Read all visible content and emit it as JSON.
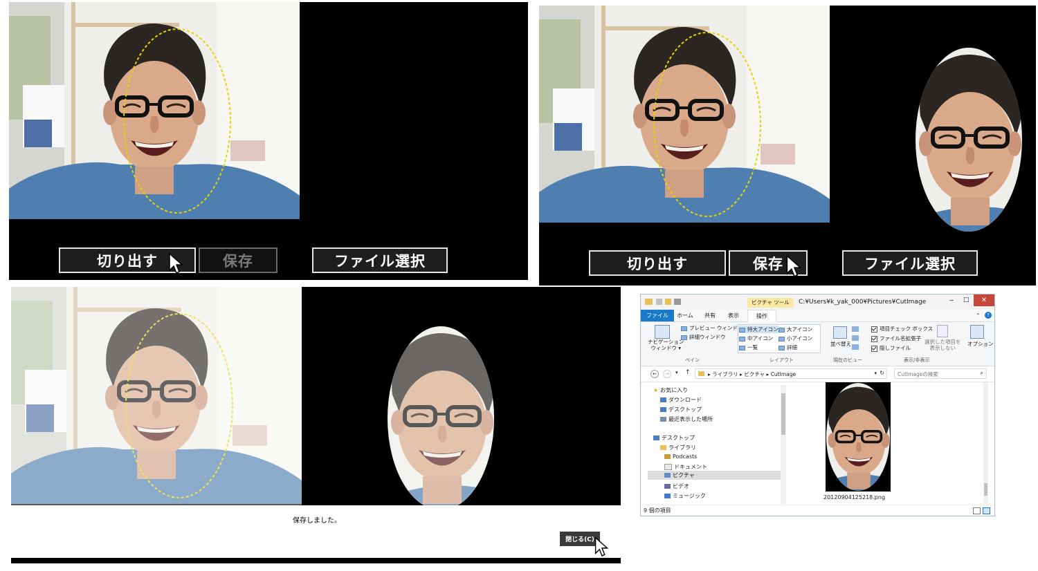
{
  "panel1": {
    "buttons": {
      "cut": "切り出す",
      "save": "保存",
      "select_file": "ファイル選択"
    }
  },
  "panel2": {
    "buttons": {
      "cut": "切り出す",
      "save": "保存",
      "select_file": "ファイル選択"
    }
  },
  "panel3": {
    "message": "保存しました。",
    "close_button": "閉じる(C)"
  },
  "explorer": {
    "context_tab": "ピクチャ ツール",
    "title": "C:¥Users¥k_yak_000¥Pictures¥CutImage",
    "tabs": [
      "ファイル",
      "ホーム",
      "共有",
      "表示",
      "操作"
    ],
    "ribbon": {
      "nav_pane": "ナビゲーション\nウィンドウ ▾",
      "preview_pane": "プレビュー ウィンドウ",
      "details_pane": "詳細ウィンドウ",
      "pane_group": "ペイン",
      "layout_items": [
        "特大アイコン",
        "大アイコン",
        "中アイコン",
        "小アイコン",
        "一覧",
        "詳細"
      ],
      "layout_group": "レイアウト",
      "sort": "並べ替え",
      "view_group": "現在のビュー",
      "checkboxes": [
        "項目チェック ボックス",
        "ファイル名拡張子",
        "隠しファイル"
      ],
      "hide_selected": "選択した項目を\n表示しない",
      "show_hide_group": "表示/非表示",
      "options": "オプション"
    },
    "breadcrumb": [
      "ライブラリ",
      "ピクチャ",
      "CutImage"
    ],
    "search_placeholder": "CutImageの検索",
    "nav": {
      "favorites": "お気に入り",
      "downloads": "ダウンロード",
      "desktop_fav": "デスクトップ",
      "recent": "最近表示した場所",
      "desktop": "デスクトップ",
      "libraries": "ライブラリ",
      "podcasts": "Podcasts",
      "documents": "ドキュメント",
      "pictures": "ピクチャ",
      "videos": "ビデオ",
      "music": "ミュージック"
    },
    "file_name": "20120904125218.png",
    "status": "9 個の項目"
  },
  "colors": {
    "panel_bg": "#000000",
    "dash_ellipse": "#e6d400",
    "shirt": "#4f7fb0",
    "skin": "#d9a98a",
    "hair": "#2b2622"
  }
}
